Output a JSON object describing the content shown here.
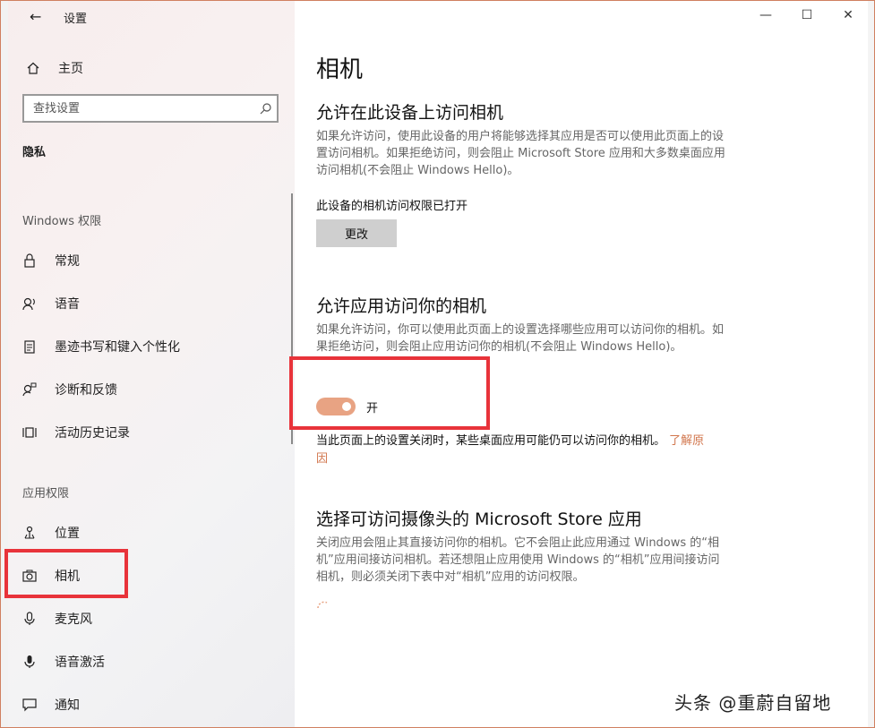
{
  "window": {
    "title": "设置",
    "back_glyph": "←",
    "minimize_glyph": "—",
    "maximize_glyph": "☐",
    "close_glyph": "✕"
  },
  "sidebar": {
    "home_label": "主页",
    "search_placeholder": "查找设置",
    "section_title": "隐私",
    "groups": [
      {
        "label": "Windows 权限",
        "items": [
          {
            "label": "常规",
            "icon": "lock-icon"
          },
          {
            "label": "语音",
            "icon": "speech-icon"
          },
          {
            "label": "墨迹书写和键入个性化",
            "icon": "clipboard-icon"
          },
          {
            "label": "诊断和反馈",
            "icon": "feedback-icon"
          },
          {
            "label": "活动历史记录",
            "icon": "timeline-icon"
          }
        ]
      },
      {
        "label": "应用权限",
        "items": [
          {
            "label": "位置",
            "icon": "location-icon"
          },
          {
            "label": "相机",
            "icon": "camera-icon"
          },
          {
            "label": "麦克风",
            "icon": "microphone-icon"
          },
          {
            "label": "语音激活",
            "icon": "voice-activation-icon"
          },
          {
            "label": "通知",
            "icon": "notification-icon"
          }
        ]
      }
    ]
  },
  "main": {
    "page_title": "相机",
    "section1": {
      "heading": "允许在此设备上访问相机",
      "description": "如果允许访问，使用此设备的用户将能够选择其应用是否可以使用此页面上的设置访问相机。如果拒绝访问，则会阻止 Microsoft Store 应用和大多数桌面应用访问相机(不会阻止 Windows Hello)。",
      "status": "此设备的相机访问权限已打开",
      "button": "更改"
    },
    "section2": {
      "heading": "允许应用访问你的相机",
      "description": "如果允许访问，你可以使用此页面上的设置选择哪些应用可以访问你的相机。如果拒绝访问，则会阻止应用访问你的相机(不会阻止 Windows Hello)。",
      "toggle_state": "开",
      "note": "当此页面上的设置关闭时，某些桌面应用可能仍可以访问你的相机。",
      "link": "了解原因"
    },
    "section3": {
      "heading": "选择可访问摄像头的 Microsoft Store 应用",
      "description": "关闭应用会阻止其直接访问你的相机。它不会阻止此应用通过 Windows 的“相机”应用间接访问相机。若还想阻止应用使用 Windows 的“相机”应用间接访问相机，则必须关闭下表中对“相机”应用的访问权限。"
    }
  },
  "watermark": "头条 @重蔚自留地",
  "colors": {
    "accent": "#e8a383",
    "link": "#d2774e",
    "highlight": "#e8333a"
  }
}
